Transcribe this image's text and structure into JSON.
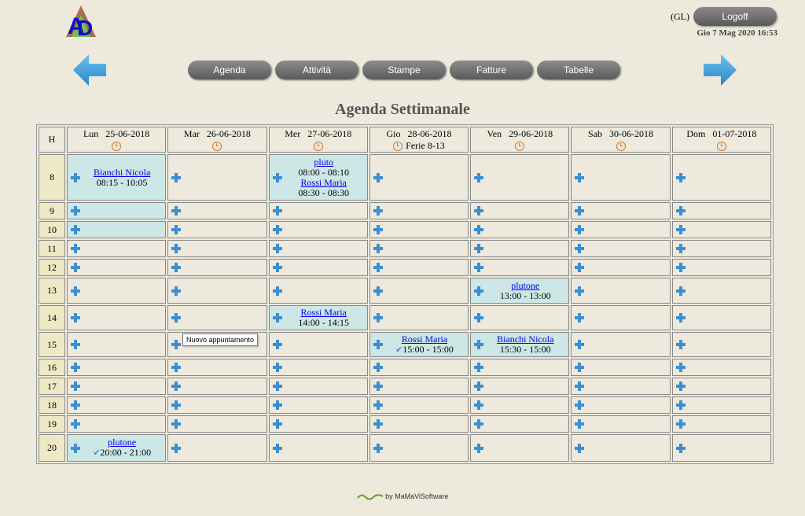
{
  "header": {
    "user_code": "(GL)",
    "logoff_label": "Logoff",
    "datetime": "Gio 7 Mag 2020 16:53"
  },
  "nav": [
    "Agenda",
    "Attività",
    "Stampe",
    "Fatture",
    "Tabelle"
  ],
  "page_title": "Agenda Settimanale",
  "agenda": {
    "hour_header": "H",
    "days": [
      {
        "label": "Lun   25-06-2018",
        "note": ""
      },
      {
        "label": "Mar   26-06-2018",
        "note": ""
      },
      {
        "label": "Mer   27-06-2018",
        "note": ""
      },
      {
        "label": "Gio   28-06-2018",
        "note": "Ferie 8-13"
      },
      {
        "label": "Ven   29-06-2018",
        "note": ""
      },
      {
        "label": "Sab   30-06-2018",
        "note": ""
      },
      {
        "label": "Dom   01-07-2018",
        "note": ""
      }
    ],
    "rows": [
      {
        "hour": "8",
        "cells": [
          {
            "booked": true,
            "appointments": [
              {
                "name": "Bianchi Nicola",
                "time": "08:15 - 10:05"
              }
            ]
          },
          {},
          {
            "booked": true,
            "appointments": [
              {
                "name": "pluto",
                "time": "08:00 - 08:10"
              },
              {
                "name": "Rossi Maria",
                "time": "08:30 - 08:30"
              }
            ]
          },
          {},
          {},
          {},
          {}
        ]
      },
      {
        "hour": "9",
        "cells": [
          {
            "booked": true
          },
          {},
          {},
          {},
          {},
          {},
          {}
        ]
      },
      {
        "hour": "10",
        "cells": [
          {
            "booked": true
          },
          {},
          {},
          {},
          {},
          {},
          {}
        ]
      },
      {
        "hour": "11",
        "cells": [
          {},
          {},
          {},
          {},
          {},
          {},
          {}
        ]
      },
      {
        "hour": "12",
        "cells": [
          {},
          {},
          {},
          {},
          {},
          {},
          {}
        ]
      },
      {
        "hour": "13",
        "cells": [
          {},
          {},
          {},
          {},
          {
            "booked": true,
            "appointments": [
              {
                "name": "plutone",
                "time": "13:00 - 13:00"
              }
            ]
          },
          {},
          {}
        ]
      },
      {
        "hour": "14",
        "cells": [
          {},
          {},
          {
            "booked": true,
            "appointments": [
              {
                "name": "Rossi Maria",
                "time": "14:00 - 14:15"
              }
            ]
          },
          {},
          {},
          {},
          {}
        ]
      },
      {
        "hour": "15",
        "cells": [
          {},
          {},
          {},
          {
            "booked": true,
            "appointments": [
              {
                "name": "Rossi Maria",
                "time": "15:00 - 15:00",
                "done": true
              }
            ]
          },
          {
            "booked": true,
            "appointments": [
              {
                "name": "Bianchi Nicola",
                "time": "15:30 - 15:00"
              }
            ]
          },
          {},
          {}
        ]
      },
      {
        "hour": "16",
        "cells": [
          {},
          {},
          {},
          {},
          {},
          {},
          {}
        ]
      },
      {
        "hour": "17",
        "cells": [
          {},
          {},
          {},
          {},
          {},
          {},
          {}
        ]
      },
      {
        "hour": "18",
        "cells": [
          {},
          {},
          {},
          {},
          {},
          {},
          {}
        ]
      },
      {
        "hour": "19",
        "cells": [
          {},
          {},
          {},
          {},
          {},
          {},
          {}
        ]
      },
      {
        "hour": "20",
        "cells": [
          {
            "booked": true,
            "appointments": [
              {
                "name": "plutone",
                "time": "20:00 - 21:00",
                "done": true
              }
            ]
          },
          {},
          {},
          {},
          {},
          {},
          {}
        ]
      }
    ]
  },
  "tooltip": "Nuovo appuntamento",
  "footer": "by MaMaViSoftware",
  "colors": {
    "background": "#ede9dc",
    "booked": "#cde6e6",
    "hour_cell": "#efe8c5",
    "accent_blue": "#3a8fd4"
  }
}
